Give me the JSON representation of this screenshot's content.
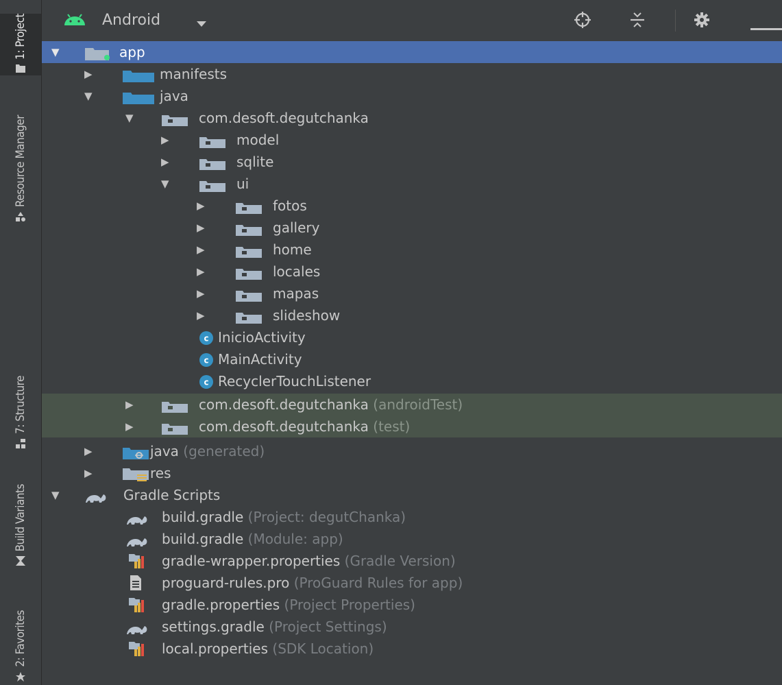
{
  "sidebar": {
    "tabs": [
      {
        "label": "1: Project",
        "icon": "folder-icon"
      },
      {
        "label": "Resource Manager",
        "icon": "resource-manager-icon"
      },
      {
        "label": "7: Structure",
        "icon": "structure-icon"
      },
      {
        "label": "Build Variants",
        "icon": "build-variants-icon"
      },
      {
        "label": "2: Favorites",
        "icon": "star-icon"
      }
    ]
  },
  "header": {
    "view_title": "Android",
    "icons": [
      "android-logo-icon",
      "chevron-down-icon",
      "locate-target-icon",
      "collapse-all-icon",
      "gear-icon",
      "minimize-icon"
    ]
  },
  "tree": [
    {
      "label": "app",
      "hint": "",
      "expanded": true,
      "icon": "module-folder-icon"
    },
    {
      "label": "manifests",
      "hint": "",
      "expanded": false,
      "icon": "folder-icon"
    },
    {
      "label": "java",
      "hint": "",
      "expanded": true,
      "icon": "folder-icon"
    },
    {
      "label": "com.desoft.degutchanka",
      "hint": "",
      "expanded": true,
      "icon": "package-icon"
    },
    {
      "label": "model",
      "hint": "",
      "expanded": false,
      "icon": "package-icon"
    },
    {
      "label": "sqlite",
      "hint": "",
      "expanded": false,
      "icon": "package-icon"
    },
    {
      "label": "ui",
      "hint": "",
      "expanded": true,
      "icon": "package-icon"
    },
    {
      "label": "fotos",
      "hint": "",
      "expanded": false,
      "icon": "package-icon"
    },
    {
      "label": "gallery",
      "hint": "",
      "expanded": false,
      "icon": "package-icon"
    },
    {
      "label": "home",
      "hint": "",
      "expanded": false,
      "icon": "package-icon"
    },
    {
      "label": "locales",
      "hint": "",
      "expanded": false,
      "icon": "package-icon"
    },
    {
      "label": "mapas",
      "hint": "",
      "expanded": false,
      "icon": "package-icon"
    },
    {
      "label": "slideshow",
      "hint": "",
      "expanded": false,
      "icon": "package-icon"
    },
    {
      "label": "InicioActivity",
      "hint": "",
      "expanded": null,
      "icon": "class-icon"
    },
    {
      "label": "MainActivity",
      "hint": "",
      "expanded": null,
      "icon": "class-icon"
    },
    {
      "label": "RecyclerTouchListener",
      "hint": "",
      "expanded": null,
      "icon": "class-icon"
    },
    {
      "label": "com.desoft.degutchanka",
      "hint": "(androidTest)",
      "expanded": false,
      "icon": "package-icon"
    },
    {
      "label": "com.desoft.degutchanka",
      "hint": "(test)",
      "expanded": false,
      "icon": "package-icon"
    },
    {
      "label": "java",
      "hint": "(generated)",
      "expanded": false,
      "icon": "generated-folder-icon"
    },
    {
      "label": "res",
      "hint": "",
      "expanded": false,
      "icon": "resource-folder-icon"
    },
    {
      "label": "Gradle Scripts",
      "hint": "",
      "expanded": true,
      "icon": "gradle-icon"
    },
    {
      "label": "build.gradle",
      "hint": "(Project: degutChanka)",
      "expanded": null,
      "icon": "gradle-icon"
    },
    {
      "label": "build.gradle",
      "hint": "(Module: app)",
      "expanded": null,
      "icon": "gradle-icon"
    },
    {
      "label": "gradle-wrapper.properties",
      "hint": "(Gradle Version)",
      "expanded": null,
      "icon": "properties-icon"
    },
    {
      "label": "proguard-rules.pro",
      "hint": "(ProGuard Rules for app)",
      "expanded": null,
      "icon": "text-file-icon"
    },
    {
      "label": "gradle.properties",
      "hint": "(Project Properties)",
      "expanded": null,
      "icon": "properties-icon"
    },
    {
      "label": "settings.gradle",
      "hint": "(Project Settings)",
      "expanded": null,
      "icon": "gradle-icon"
    },
    {
      "label": "local.properties",
      "hint": "(SDK Location)",
      "expanded": null,
      "icon": "properties-icon"
    }
  ],
  "colors": {
    "background": "#3c3f41",
    "selected_row": "#4b6eaf",
    "test_row": "#49544a",
    "folder_blue": "#3d8fc4",
    "android_green": "#3ddc84",
    "class_badge": "#3592c4",
    "hint_text": "#7a7e82"
  }
}
